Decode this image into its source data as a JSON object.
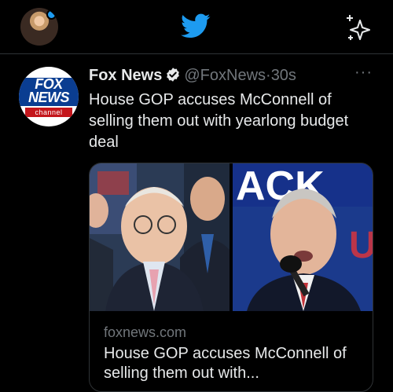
{
  "icons": {
    "bird": "twitter-bird-icon",
    "sparkle": "sparkle-icon",
    "verified": "verified-badge-icon",
    "more": "more-icon"
  },
  "colors": {
    "accent": "#1d9bf0",
    "background": "#000000",
    "text": "#e7e9ea",
    "muted": "#71767b",
    "fox_blue": "#0a3d91",
    "fox_red": "#c4161c"
  },
  "tweet": {
    "author_name": "Fox News",
    "handle": "@FoxNews",
    "separator": "·",
    "time": "30s",
    "more_label": "···",
    "text": "House GOP accuses McConnell of selling them out with yearlong budget deal",
    "avatar_logo_top": "FOX",
    "avatar_logo_bottom": "NEWS",
    "avatar_logo_channel": "channel"
  },
  "card": {
    "domain": "foxnews.com",
    "title": "House GOP accuses McConnell of selling them out with...",
    "banner_text": "ACK",
    "banner_sub": "US"
  }
}
